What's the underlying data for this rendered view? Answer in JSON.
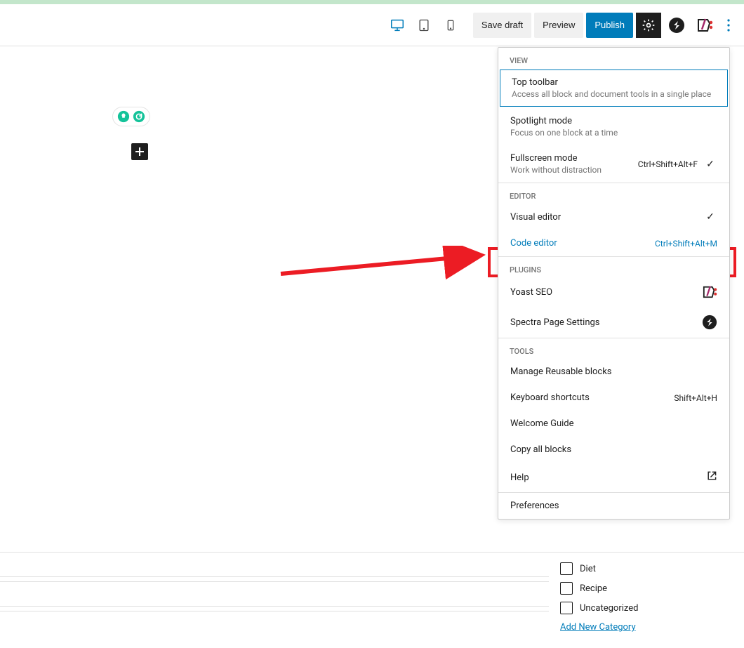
{
  "toolbar": {
    "save_draft": "Save draft",
    "preview": "Preview",
    "publish": "Publish"
  },
  "dropdown": {
    "sections": {
      "view": "VIEW",
      "editor": "EDITOR",
      "plugins": "PLUGINS",
      "tools": "TOOLS"
    },
    "top_toolbar": {
      "label": "Top toolbar",
      "desc": "Access all block and document tools in a single place"
    },
    "spotlight": {
      "label": "Spotlight mode",
      "desc": "Focus on one block at a time"
    },
    "fullscreen": {
      "label": "Fullscreen mode",
      "desc": "Work without distraction",
      "kbd": "Ctrl+Shift+Alt+F"
    },
    "visual_editor": {
      "label": "Visual editor"
    },
    "code_editor": {
      "label": "Code editor",
      "kbd": "Ctrl+Shift+Alt+M"
    },
    "yoast": {
      "label": "Yoast SEO"
    },
    "spectra": {
      "label": "Spectra Page Settings"
    },
    "reusable": {
      "label": "Manage Reusable blocks"
    },
    "shortcuts": {
      "label": "Keyboard shortcuts",
      "kbd": "Shift+Alt+H"
    },
    "welcome": {
      "label": "Welcome Guide"
    },
    "copy_all": {
      "label": "Copy all blocks"
    },
    "help": {
      "label": "Help"
    },
    "preferences": {
      "label": "Preferences"
    }
  },
  "categories": {
    "diet": "Diet",
    "recipe": "Recipe",
    "uncategorized": "Uncategorized",
    "add_new": "Add New Category"
  }
}
